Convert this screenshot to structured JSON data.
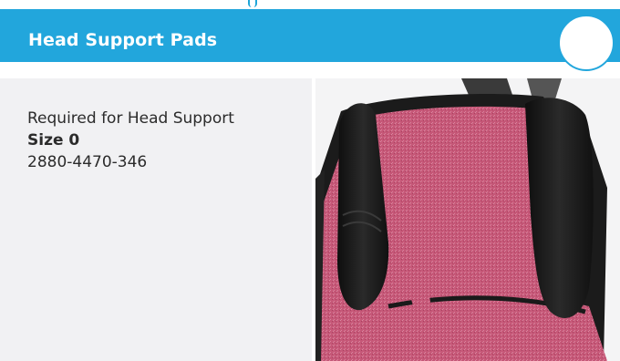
{
  "header": {
    "title": "Head Support Pads"
  },
  "info": {
    "description": "Required for Head Support",
    "size_label": "Size 0",
    "part_number": "2880-4470-346"
  },
  "product_image": {
    "subject": "head support pads on pink seat"
  },
  "colors": {
    "header_bg": "#22a6dc",
    "panel_bg": "#f1f1f3",
    "fabric_pink": "#c8587a",
    "pad_black": "#1c1c1c"
  }
}
